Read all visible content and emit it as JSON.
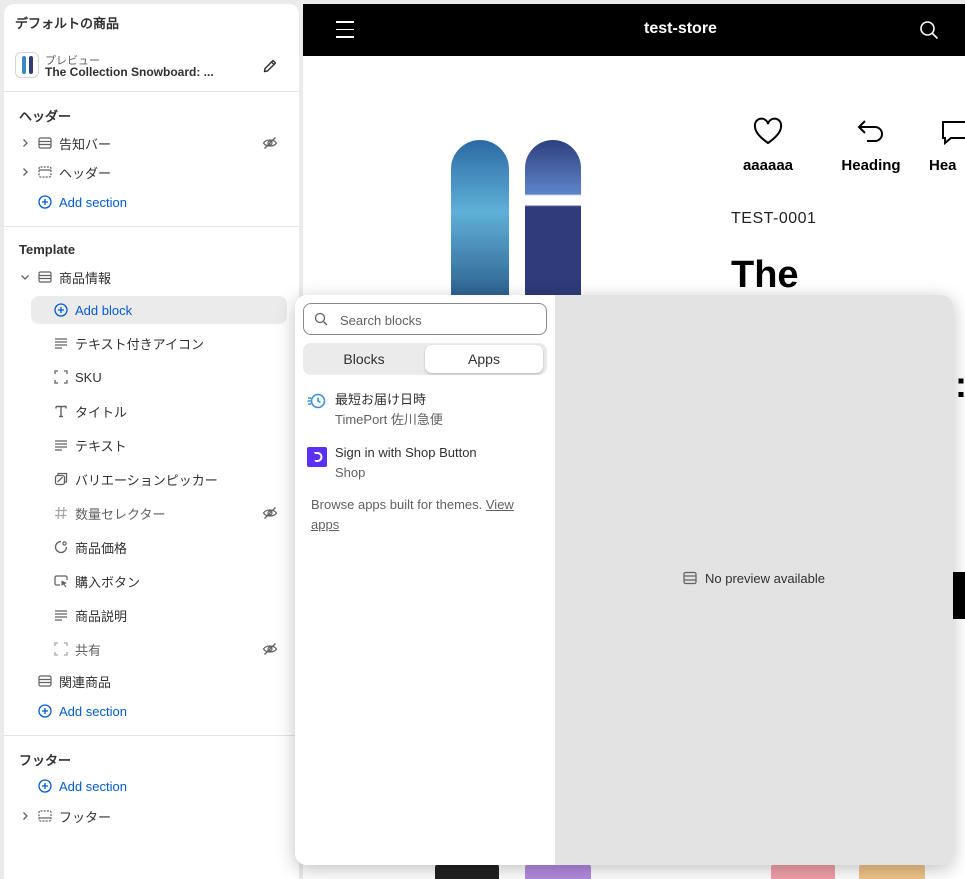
{
  "sidebar": {
    "title": "デフォルトの商品",
    "preview": {
      "label": "プレビュー",
      "product": "The Collection Snowboard: ..."
    },
    "header_section": {
      "title": "ヘッダー",
      "items": [
        {
          "label": "告知バー",
          "hidden": true
        },
        {
          "label": "ヘッダー",
          "hidden": false
        }
      ],
      "add_section": "Add section"
    },
    "template_section": {
      "title": "Template",
      "group_label": "商品情報",
      "add_block": "Add block",
      "blocks": [
        {
          "label": "テキスト付きアイコン",
          "icon": "text-align-icon",
          "hidden": false
        },
        {
          "label": "SKU",
          "icon": "barcode-frame-icon",
          "hidden": false
        },
        {
          "label": "タイトル",
          "icon": "text-t-icon",
          "hidden": false
        },
        {
          "label": "テキスト",
          "icon": "text-align-icon",
          "hidden": false
        },
        {
          "label": "バリエーションピッカー",
          "icon": "variant-icon",
          "hidden": false
        },
        {
          "label": "数量セレクター",
          "icon": "hash-icon",
          "hidden": true
        },
        {
          "label": "商品価格",
          "icon": "price-tag-icon",
          "hidden": false
        },
        {
          "label": "購入ボタン",
          "icon": "cursor-button-icon",
          "hidden": false
        },
        {
          "label": "商品説明",
          "icon": "text-align-icon",
          "hidden": false
        },
        {
          "label": "共有",
          "icon": "barcode-frame-icon",
          "hidden": true
        }
      ],
      "related": "関連商品",
      "add_section": "Add section"
    },
    "footer_section": {
      "title": "フッター",
      "add_section": "Add section",
      "items": [
        {
          "label": "フッター"
        }
      ]
    }
  },
  "store": {
    "name": "test-store",
    "features": [
      "aaaaaa",
      "Heading",
      "Hea"
    ],
    "sku": "TEST-0001",
    "product_title": "The",
    "colon": ":"
  },
  "picker": {
    "search_placeholder": "Search blocks",
    "tabs": [
      "Blocks",
      "Apps"
    ],
    "active_tab": "Apps",
    "apps": [
      {
        "name": "最短お届け日時",
        "provider": "TimePort 佐川急便",
        "icon": "clock-delivery-icon"
      },
      {
        "name": "Sign in with Shop Button",
        "provider": "Shop",
        "icon": "shop-logo-icon"
      }
    ],
    "browse_text": "Browse apps built for themes.",
    "browse_link": "View apps",
    "no_preview": "No preview available"
  },
  "colors": {
    "accent": "#005bd3",
    "shop_purple": "#5a31f4",
    "store_bar": "#000000"
  }
}
